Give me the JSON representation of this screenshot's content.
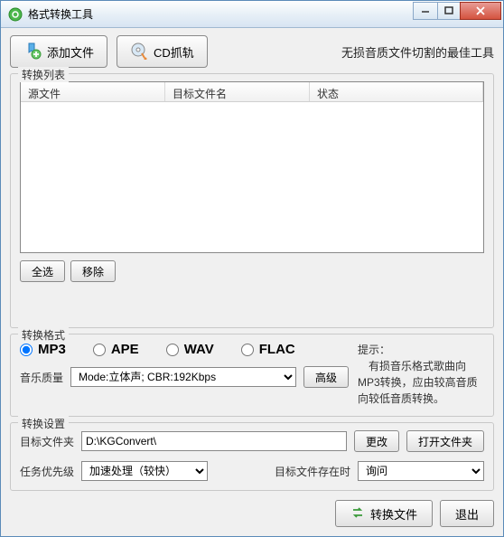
{
  "window": {
    "title": "格式转换工具"
  },
  "toolbar": {
    "add_file": "添加文件",
    "cd_rip": "CD抓轨",
    "tagline": "无损音质文件切割的最佳工具"
  },
  "list": {
    "group_title": "转换列表",
    "headers": {
      "source": "源文件",
      "target": "目标文件名",
      "status": "状态"
    },
    "select_all": "全选",
    "remove": "移除"
  },
  "format": {
    "group_title": "转换格式",
    "options": {
      "mp3": "MP3",
      "ape": "APE",
      "wav": "WAV",
      "flac": "FLAC"
    },
    "selected": "mp3",
    "quality_label": "音乐质量",
    "quality_value": "Mode:立体声; CBR:192Kbps",
    "advanced": "高级",
    "hint_title": "提示：",
    "hint_body": "有损音乐格式歌曲向MP3转换，应由较高音质向较低音质转换。"
  },
  "settings": {
    "group_title": "转换设置",
    "target_folder_label": "目标文件夹",
    "target_folder_value": "D:\\KGConvert\\",
    "change": "更改",
    "open_folder": "打开文件夹",
    "priority_label": "任务优先级",
    "priority_value": "加速处理（较快）",
    "exists_label": "目标文件存在时",
    "exists_value": "询问"
  },
  "footer": {
    "convert": "转换文件",
    "exit": "退出"
  }
}
